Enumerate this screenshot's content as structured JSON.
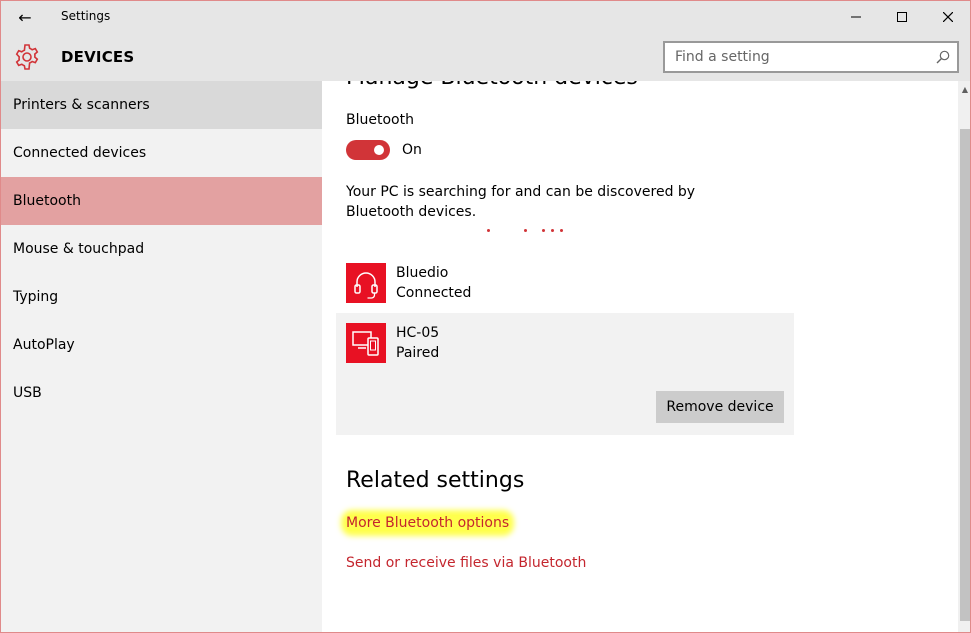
{
  "window": {
    "title": "Settings",
    "controls": {
      "minimize": "—",
      "maximize": "☐",
      "close": "✕"
    },
    "back_glyph": "←"
  },
  "header": {
    "section_title": "DEVICES",
    "search_placeholder": "Find a setting"
  },
  "sidebar": {
    "items": [
      {
        "label": "Printers & scanners"
      },
      {
        "label": "Connected devices"
      },
      {
        "label": "Bluetooth"
      },
      {
        "label": "Mouse & touchpad"
      },
      {
        "label": "Typing"
      },
      {
        "label": "AutoPlay"
      },
      {
        "label": "USB"
      }
    ]
  },
  "main": {
    "heading": "Manage Bluetooth devices",
    "bluetooth_label": "Bluetooth",
    "toggle_state": "On",
    "description": "Your PC is searching for and can be discovered by Bluetooth devices.",
    "devices": [
      {
        "name": "Bluedio",
        "status": "Connected",
        "icon": "headset-icon"
      },
      {
        "name": "HC-05",
        "status": "Paired",
        "icon": "devices-icon"
      }
    ],
    "remove_button": "Remove device",
    "related_heading": "Related settings",
    "links": [
      {
        "label": "More Bluetooth options"
      },
      {
        "label": "Send or receive files via Bluetooth"
      }
    ]
  },
  "colors": {
    "accent": "#d13438",
    "selected_nav": "#e3a1a1",
    "device_tile": "#e81123",
    "link": "#c4262e",
    "highlight": "#ffff4d"
  }
}
